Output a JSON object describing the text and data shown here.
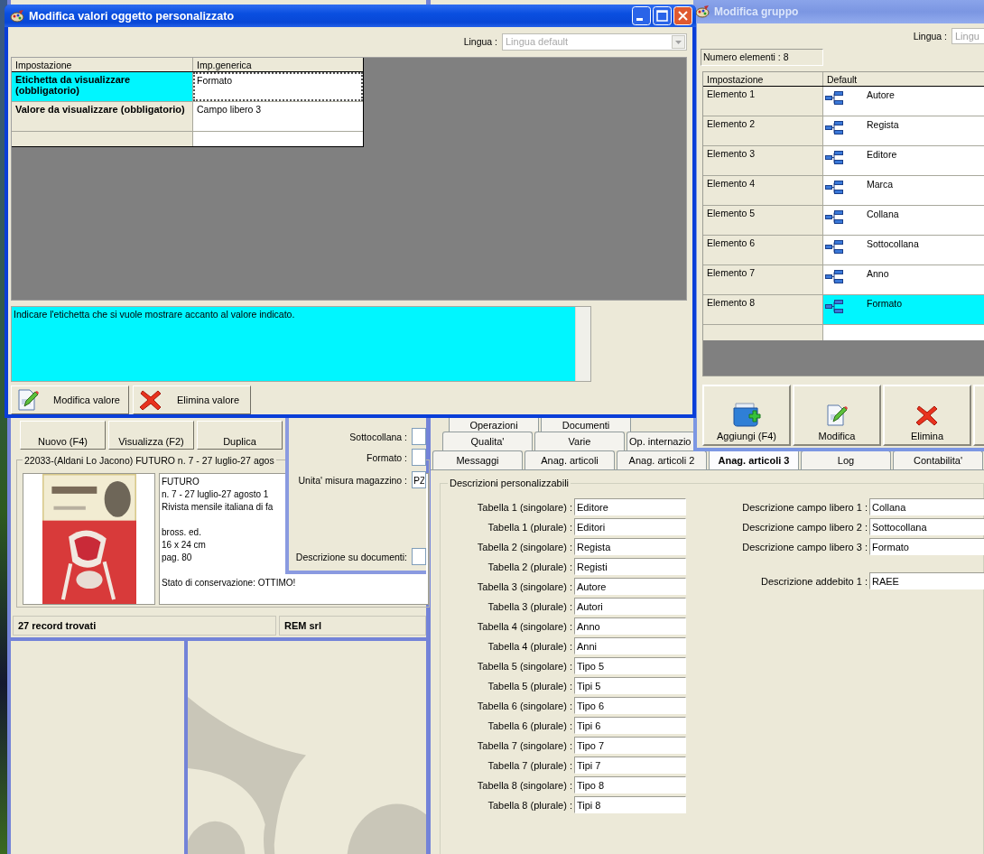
{
  "dialog": {
    "title": "Modifica valori oggetto personalizzato",
    "language": {
      "label": "Lingua :",
      "value": "Lingua default"
    },
    "table": {
      "columns": [
        "Impostazione",
        "Imp.generica"
      ],
      "rows": [
        {
          "setting": "Etichetta da visualizzare (obbligatorio)",
          "value": "Formato",
          "selected": true
        },
        {
          "setting": "Valore da visualizzare (obbligatorio)",
          "value": "Campo libero 3",
          "selected": false
        }
      ]
    },
    "hint": "Indicare l'etichetta che si vuole mostrare accanto al valore indicato.",
    "buttons": [
      {
        "label": "Modifica valore"
      },
      {
        "label": "Elimina valore"
      }
    ]
  },
  "group_window": {
    "title": "Modifica gruppo",
    "language": {
      "label": "Lingua :",
      "placeholder": "Lingu"
    },
    "count": "Numero elementi : 8",
    "columns": [
      "Impostazione",
      "Default"
    ],
    "rows": [
      {
        "name": "Elemento 1",
        "value": "Autore",
        "selected": false
      },
      {
        "name": "Elemento 2",
        "value": "Regista",
        "selected": false
      },
      {
        "name": "Elemento 3",
        "value": "Editore",
        "selected": false
      },
      {
        "name": "Elemento 4",
        "value": "Marca",
        "selected": false
      },
      {
        "name": "Elemento 5",
        "value": "Collana",
        "selected": false
      },
      {
        "name": "Elemento 6",
        "value": "Sottocollana",
        "selected": false
      },
      {
        "name": "Elemento 7",
        "value": "Anno",
        "selected": false
      },
      {
        "name": "Elemento 8",
        "value": "Formato",
        "selected": true
      }
    ],
    "buttons": [
      {
        "label": "Aggiungi (F4)"
      },
      {
        "label": "Modifica"
      },
      {
        "label": "Elimina"
      }
    ]
  },
  "main": {
    "toolbar": [
      "Nuovo (F4)",
      "Visualizza (F2)",
      "Duplica"
    ],
    "record": {
      "title": "22033-(Aldani Lo Jacono) FUTURO n. 7 - 27 luglio-27 agos",
      "paragraphs": [
        [
          "FUTURO",
          "n. 7 - 27 luglio-27 agosto 1",
          "Rivista mensile italiana di fa"
        ],
        [
          "bross. ed.",
          "16 x 24 cm",
          "pag. 80"
        ],
        [
          "Stato di conservazione: OTTIMO!"
        ]
      ]
    },
    "detail_fields": [
      {
        "label": "Sottocollana :"
      },
      {
        "label": "Formato :"
      },
      {
        "label": "Unita' misura magazzino :",
        "value": "PZ"
      },
      {
        "label": "Descrizione su documenti:"
      }
    ],
    "status_bar": [
      "27 record trovati",
      "REM srl"
    ],
    "tab_rows": [
      [
        {
          "label": "Operazioni",
          "selected": false
        },
        {
          "label": "Documenti",
          "selected": false
        }
      ],
      [
        {
          "label": "Qualita'",
          "selected": false
        },
        {
          "label": "Varie",
          "selected": false
        },
        {
          "label": "Op. internazio",
          "selected": false
        }
      ],
      [
        {
          "label": "Messaggi",
          "selected": false
        },
        {
          "label": "Anag. articoli",
          "selected": false
        },
        {
          "label": "Anag. articoli 2",
          "selected": false
        },
        {
          "label": "Anag. articoli 3",
          "selected": true
        },
        {
          "label": "Log",
          "selected": false
        },
        {
          "label": "Contabilita'",
          "selected": false
        }
      ]
    ],
    "section": "Descrizioni personalizzabili",
    "left_field_groups": [
      [
        {
          "label": "Tabella 1 (singolare) :",
          "value": "Editore"
        },
        {
          "label": "Tabella 1 (plurale) :",
          "value": "Editori"
        }
      ],
      [
        {
          "label": "Tabella 2 (singolare) :",
          "value": "Regista"
        },
        {
          "label": "Tabella 2 (plurale) :",
          "value": "Registi"
        }
      ],
      [
        {
          "label": "Tabella 3 (singolare) :",
          "value": "Autore"
        },
        {
          "label": "Tabella 3 (plurale) :",
          "value": "Autori"
        }
      ],
      [
        {
          "label": "Tabella 4 (singolare) :",
          "value": "Anno"
        },
        {
          "label": "Tabella 4 (plurale) :",
          "value": "Anni"
        }
      ],
      [
        {
          "label": "Tabella 5 (singolare) :",
          "value": "Tipo 5"
        },
        {
          "label": "Tabella 5 (plurale) :",
          "value": "Tipi 5"
        }
      ],
      [
        {
          "label": "Tabella 6 (singolare) :",
          "value": "Tipo 6"
        },
        {
          "label": "Tabella 6 (plurale) :",
          "value": "Tipi 6"
        }
      ],
      [
        {
          "label": "Tabella 7 (singolare) :",
          "value": "Tipo 7"
        },
        {
          "label": "Tabella 7 (plurale) :",
          "value": "Tipi 7"
        }
      ],
      [
        {
          "label": "Tabella 8 (singolare) :",
          "value": "Tipo 8"
        },
        {
          "label": "Tabella 8 (plurale) :",
          "value": "Tipi 8"
        }
      ]
    ],
    "right_field_groups": [
      [
        {
          "label": "Descrizione campo libero 1 :",
          "value": "Collana"
        },
        {
          "label": "Descrizione campo libero 2 :",
          "value": "Sottocollana"
        },
        {
          "label": "Descrizione campo libero 3 :",
          "value": "Formato"
        }
      ],
      [
        {
          "label": "Descrizione addebito 1 :",
          "value": "RAEE"
        }
      ]
    ]
  }
}
